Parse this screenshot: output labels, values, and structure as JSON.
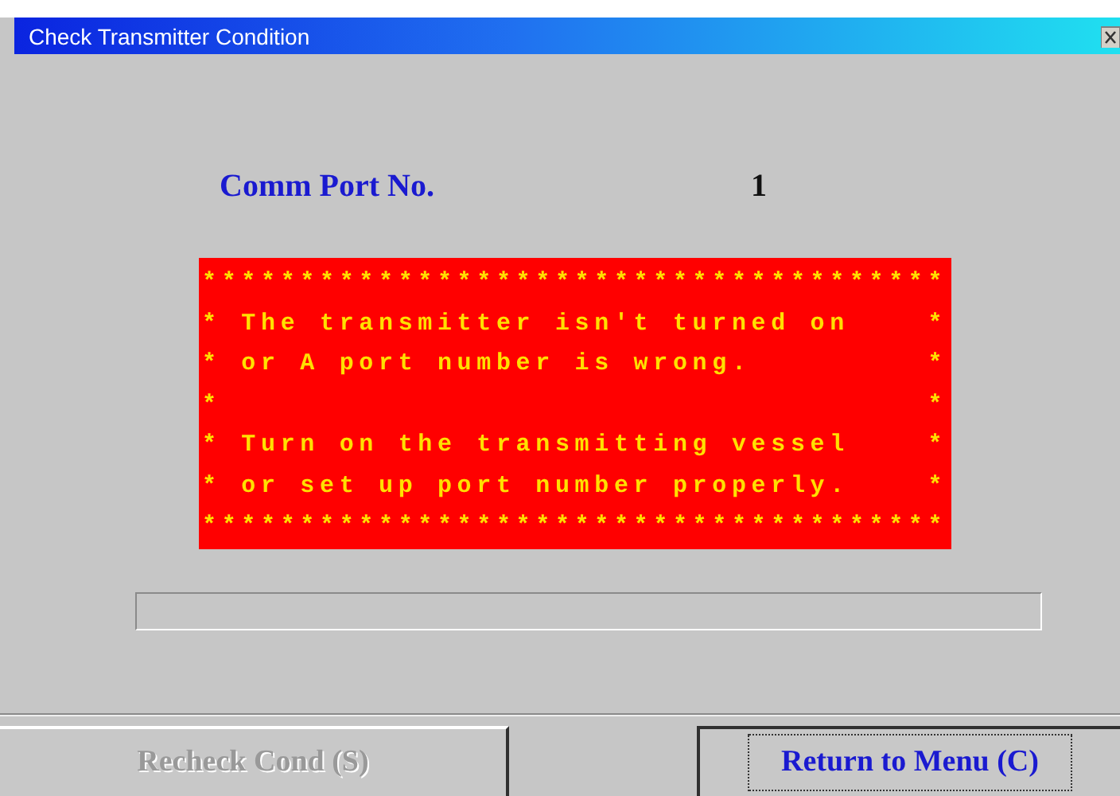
{
  "window": {
    "title": "Check Transmitter Condition"
  },
  "fields": [
    {
      "label": "Comm Port No.",
      "value": "1"
    }
  ],
  "error_banner": {
    "lines": [
      "**************************************",
      "* The transmitter isn't turned on    *",
      "* or A port number is wrong.         *",
      "*                                    *",
      "* Turn on the transmitting vessel    *",
      "* or set up port number properly.    *",
      "**************************************"
    ]
  },
  "buttons": [
    {
      "label": "Recheck Cond (S)",
      "disabled": true,
      "focused": false
    },
    {
      "label": "Return to Menu (C)",
      "disabled": false,
      "focused": true
    }
  ]
}
